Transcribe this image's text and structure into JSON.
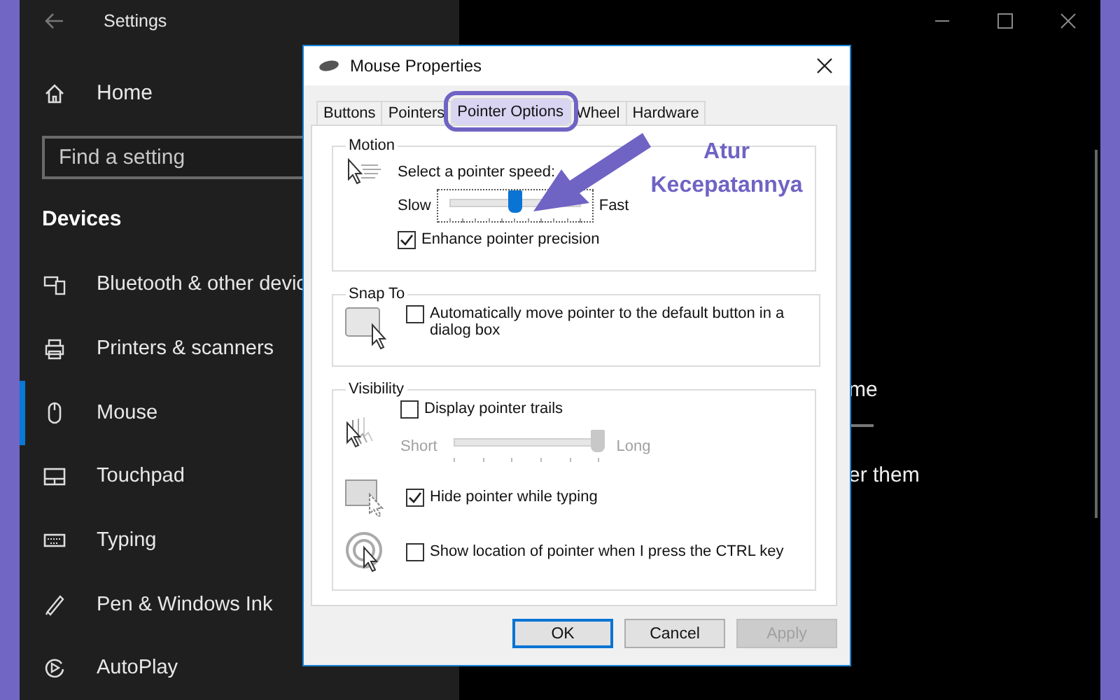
{
  "settings": {
    "title": "Settings",
    "home": "Home",
    "search": {
      "placeholder": "Find a setting"
    },
    "section": "Devices",
    "nav": [
      {
        "label": "Bluetooth & other devic",
        "selected": false
      },
      {
        "label": "Printers & scanners",
        "selected": false
      },
      {
        "label": "Mouse",
        "selected": true
      },
      {
        "label": "Touchpad",
        "selected": false
      },
      {
        "label": "Typing",
        "selected": false
      },
      {
        "label": "Pen & Windows Ink",
        "selected": false
      },
      {
        "label": "AutoPlay",
        "selected": false
      }
    ],
    "content": [
      "me",
      "er them"
    ]
  },
  "dialog": {
    "title": "Mouse Properties",
    "tabs": [
      {
        "label": "Buttons",
        "selected": false,
        "highlighted": false
      },
      {
        "label": "Pointers",
        "selected": false,
        "highlighted": false
      },
      {
        "label": "Pointer Options",
        "selected": true,
        "highlighted": true
      },
      {
        "label": "Wheel",
        "selected": false,
        "highlighted": false
      },
      {
        "label": "Hardware",
        "selected": false,
        "highlighted": false
      }
    ],
    "motion": {
      "title": "Motion",
      "speed_label": "Select a pointer speed:",
      "slow": "Slow",
      "fast": "Fast",
      "level": 0.5,
      "checkbox": {
        "label": "Enhance pointer precision",
        "checked": true
      }
    },
    "snap_to": {
      "title": "Snap To",
      "checkbox": {
        "label": "Automatically move pointer to the default button in a dialog box",
        "checked": false
      }
    },
    "visibility": {
      "title": "Visibility",
      "trails": {
        "label": "Display pointer trails",
        "checked": false,
        "short": "Short",
        "long": "Long",
        "level": 1,
        "disabled": true
      },
      "hide": {
        "label": "Hide pointer while typing",
        "checked": true
      },
      "show_location": {
        "label": "Show location of pointer when I press the CTRL key",
        "checked": false
      }
    },
    "buttons": [
      {
        "label": "OK",
        "default": true,
        "disabled": false
      },
      {
        "label": "Cancel",
        "default": false,
        "disabled": false
      },
      {
        "label": "Apply",
        "default": false,
        "disabled": true
      }
    ]
  },
  "annotation": {
    "text": "Atur Kecepatannya"
  }
}
